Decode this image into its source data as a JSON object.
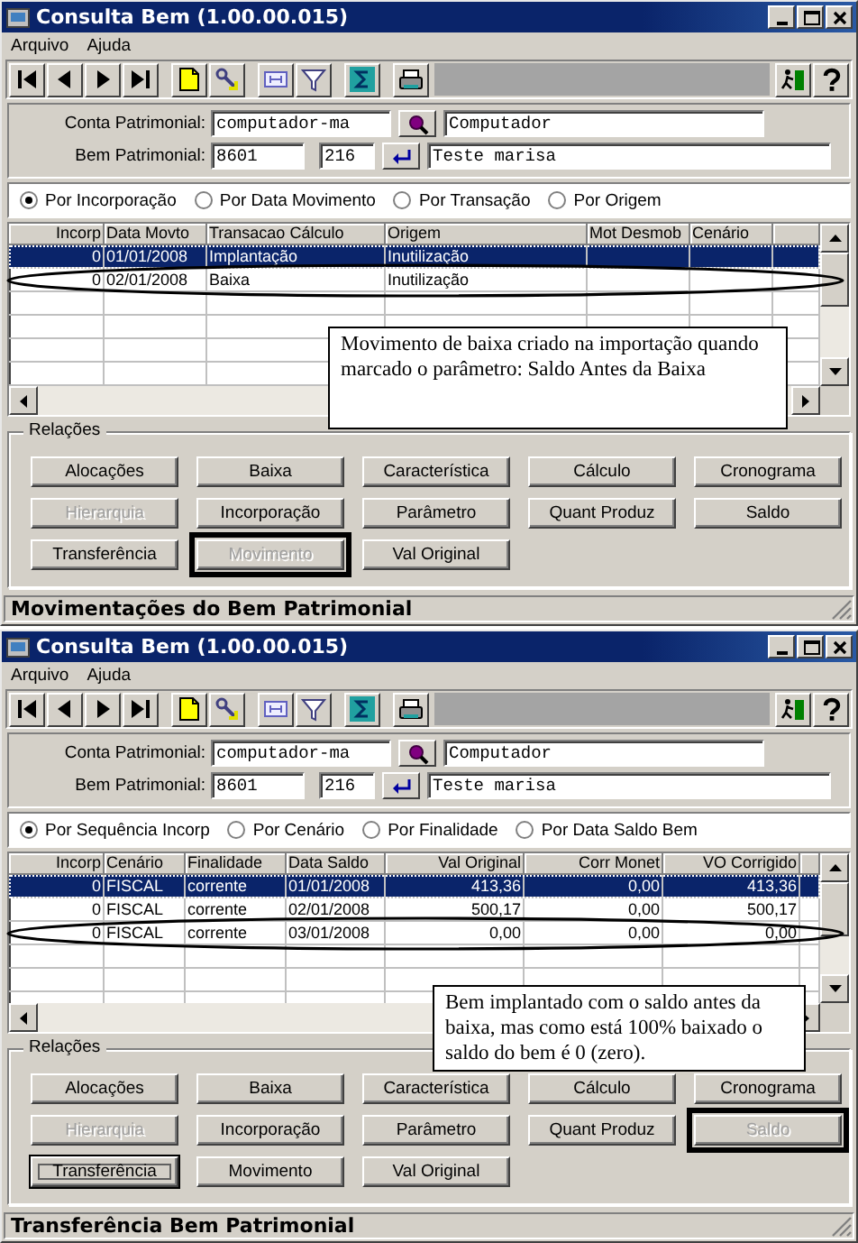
{
  "windows": [
    {
      "title": "Consulta Bem (1.00.00.015)",
      "menu": [
        "Arquivo",
        "Ajuda"
      ],
      "fields": [
        {
          "label": "Conta Patrimonial:",
          "values": [
            "computador-ma"
          ],
          "description": "Computador"
        },
        {
          "label": "Bem Patrimonial:",
          "values": [
            "8601",
            "216"
          ],
          "description": "Teste marisa"
        }
      ],
      "sort_options": [
        {
          "label": "Por Incorporação",
          "selected": true
        },
        {
          "label": "Por Data Movimento",
          "selected": false
        },
        {
          "label": "Por Transação",
          "selected": false
        },
        {
          "label": "Por Origem",
          "selected": false
        }
      ],
      "table": {
        "columns": [
          {
            "label": "Incorp"
          },
          {
            "label": "Data Movto"
          },
          {
            "label": "Transacao Cálculo"
          },
          {
            "label": "Origem"
          },
          {
            "label": "Mot Desmob"
          },
          {
            "label": "Cenário"
          }
        ],
        "rows": [
          {
            "cells": [
              "0",
              "01/01/2008",
              "Implantação",
              "Inutilização"
            ],
            "selected": true,
            "circled": false
          },
          {
            "cells": [
              "0",
              "02/01/2008",
              "Baixa",
              "Inutilização"
            ],
            "selected": false,
            "circled": true
          }
        ]
      },
      "note": "Movimento de baixa criado na importação quando marcado o parâmetro: Saldo Antes da Baixa",
      "relations": {
        "title": "Relações",
        "buttons": [
          {
            "label": "Alocações",
            "disabled": false,
            "framed": false,
            "focused": false
          },
          {
            "label": "Baixa",
            "disabled": false,
            "framed": false,
            "focused": false
          },
          {
            "label": "Característica",
            "disabled": false,
            "framed": false,
            "focused": false
          },
          {
            "label": "Cálculo",
            "disabled": false,
            "framed": false,
            "focused": false
          },
          {
            "label": "Cronograma",
            "disabled": false,
            "framed": false,
            "focused": false
          },
          {
            "label": "Hierarquia",
            "disabled": true,
            "framed": false,
            "focused": false
          },
          {
            "label": "Incorporação",
            "disabled": false,
            "framed": false,
            "focused": false
          },
          {
            "label": "Parâmetro",
            "disabled": false,
            "framed": false,
            "focused": false
          },
          {
            "label": "Quant Produz",
            "disabled": false,
            "framed": false,
            "focused": false
          },
          {
            "label": "Saldo",
            "disabled": false,
            "framed": false,
            "focused": false
          },
          {
            "label": "Transferência",
            "disabled": false,
            "framed": false,
            "focused": false
          },
          {
            "label": "Movimento",
            "disabled": true,
            "framed": true,
            "focused": false
          },
          {
            "label": "Val Original",
            "disabled": false,
            "framed": false,
            "focused": false
          }
        ]
      },
      "status_bar": "Movimentações do Bem Patrimonial"
    },
    {
      "title": "Consulta Bem (1.00.00.015)",
      "menu": [
        "Arquivo",
        "Ajuda"
      ],
      "fields": [
        {
          "label": "Conta Patrimonial:",
          "values": [
            "computador-ma"
          ],
          "description": "Computador"
        },
        {
          "label": "Bem Patrimonial:",
          "values": [
            "8601",
            "216"
          ],
          "description": "Teste marisa"
        }
      ],
      "sort_options": [
        {
          "label": "Por Sequência Incorp",
          "selected": true
        },
        {
          "label": "Por Cenário",
          "selected": false
        },
        {
          "label": "Por Finalidade",
          "selected": false
        },
        {
          "label": "Por Data Saldo Bem",
          "selected": false
        }
      ],
      "table": {
        "columns": [
          {
            "label": "Incorp"
          },
          {
            "label": "Cenário"
          },
          {
            "label": "Finalidade"
          },
          {
            "label": "Data Saldo"
          },
          {
            "label": "Val Original"
          },
          {
            "label": "Corr Monet"
          },
          {
            "label": "VO Corrigido"
          }
        ],
        "rows": [
          {
            "cells": [
              "0",
              "FISCAL",
              "corrente",
              "01/01/2008",
              "413,36",
              "0,00",
              "413,36"
            ],
            "selected": true,
            "circled": false
          },
          {
            "cells": [
              "0",
              "FISCAL",
              "corrente",
              "02/01/2008",
              "500,17",
              "0,00",
              "500,17"
            ],
            "selected": false,
            "circled": false
          },
          {
            "cells": [
              "0",
              "FISCAL",
              "corrente",
              "03/01/2008",
              "0,00",
              "0,00",
              "0,00"
            ],
            "selected": false,
            "circled": true
          }
        ]
      },
      "note": "Bem implantado com o saldo antes da baixa, mas como está 100% baixado o saldo do bem é 0 (zero).",
      "relations": {
        "title": "Relações",
        "buttons": [
          {
            "label": "Alocações",
            "disabled": false,
            "framed": false,
            "focused": false
          },
          {
            "label": "Baixa",
            "disabled": false,
            "framed": false,
            "focused": false
          },
          {
            "label": "Característica",
            "disabled": false,
            "framed": false,
            "focused": false
          },
          {
            "label": "Cálculo",
            "disabled": false,
            "framed": false,
            "focused": false
          },
          {
            "label": "Cronograma",
            "disabled": false,
            "framed": false,
            "focused": false
          },
          {
            "label": "Hierarquia",
            "disabled": true,
            "framed": false,
            "focused": false
          },
          {
            "label": "Incorporação",
            "disabled": false,
            "framed": false,
            "focused": false
          },
          {
            "label": "Parâmetro",
            "disabled": false,
            "framed": false,
            "focused": false
          },
          {
            "label": "Quant Produz",
            "disabled": false,
            "framed": false,
            "focused": false
          },
          {
            "label": "Saldo",
            "disabled": true,
            "framed": true,
            "focused": false
          },
          {
            "label": "Transferência",
            "disabled": false,
            "framed": false,
            "focused": true
          },
          {
            "label": "Movimento",
            "disabled": false,
            "framed": false,
            "focused": false
          },
          {
            "label": "Val Original",
            "disabled": false,
            "framed": false,
            "focused": false
          }
        ]
      },
      "status_bar": "Transferência Bem Patrimonial"
    }
  ]
}
